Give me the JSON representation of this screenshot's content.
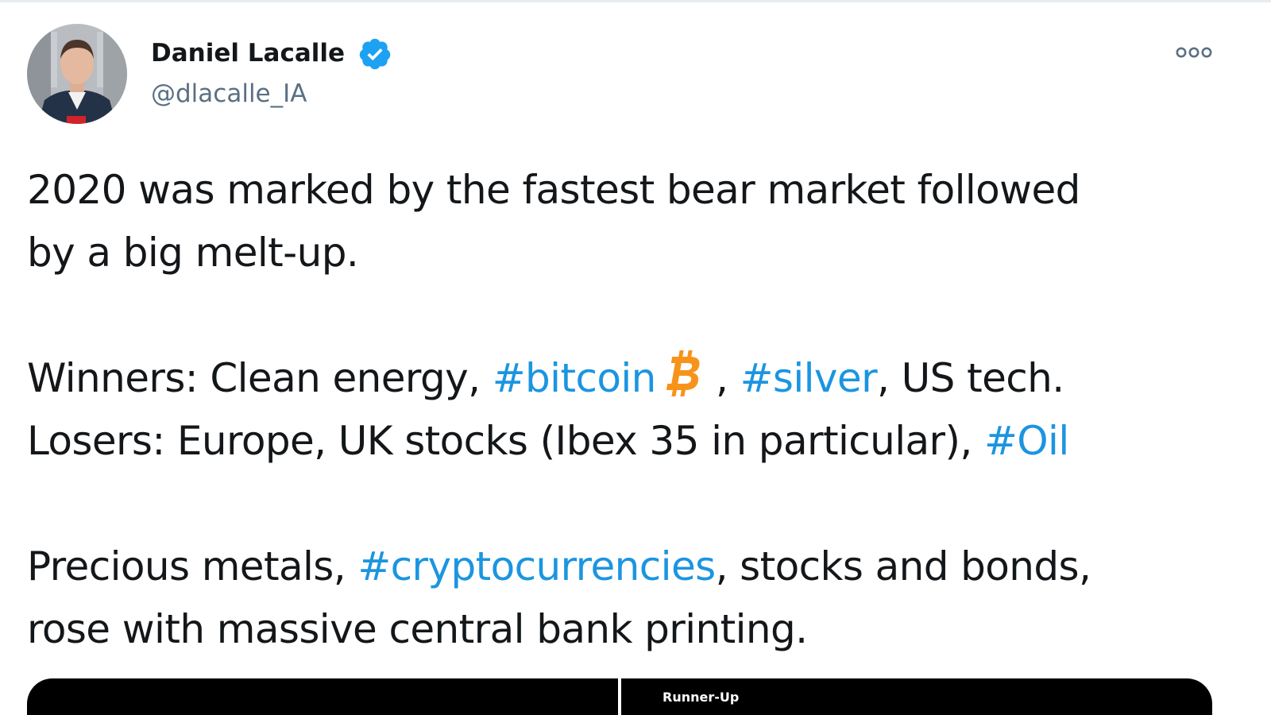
{
  "author": {
    "name": "Daniel Lacalle",
    "handle": "@dlacalle_IA",
    "verified": true,
    "avatar_icon": "profile-photo"
  },
  "more_menu_icon": "ellipsis-icon",
  "tweet": {
    "line1": "2020 was marked by the fastest bear market followed",
    "line2": "by a big melt-up.",
    "winners_label": "Winners: Clean energy, ",
    "tag_bitcoin": "#bitcoin",
    "bitcoin_icon": "bitcoin-icon",
    "sep1": " , ",
    "tag_silver": "#silver",
    "winners_tail": ", US tech.",
    "losers_label": "Losers: Europe, UK stocks (Ibex 35 in particular), ",
    "tag_oil": "#Oil",
    "precious_label": "Precious metals, ",
    "tag_crypto": "#cryptocurrencies",
    "precious_tail": ", stocks and bonds,",
    "last_line": "rose with massive central bank printing."
  },
  "media": {
    "right_label": "Runner-Up"
  },
  "colors": {
    "hashtag": "#1b95e0",
    "text": "#14171a",
    "secondary_text": "#5b7083",
    "verified_badge": "#1da1f2",
    "bitcoin": "#f7931a"
  }
}
